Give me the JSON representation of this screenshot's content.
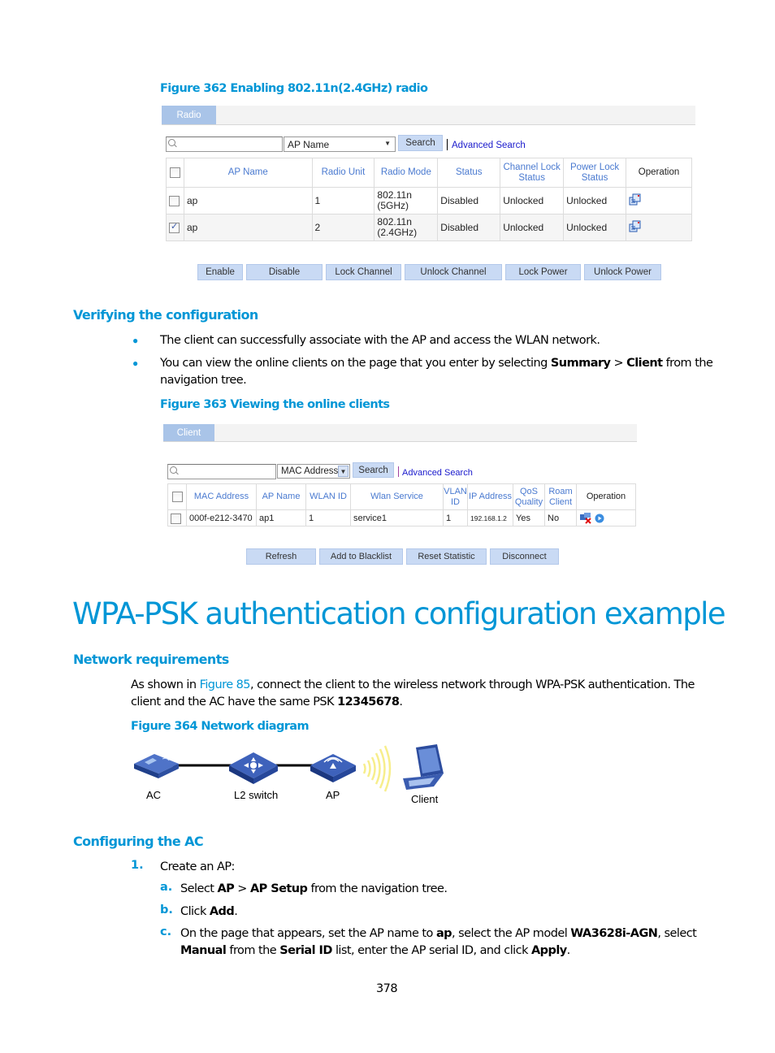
{
  "figure362": {
    "caption": "Figure 362 Enabling 802.11n(2.4GHz) radio",
    "tab": "Radio",
    "search": {
      "placeholder": "",
      "field": "AP Name",
      "button": "Search",
      "advanced": "Advanced Search"
    },
    "columns": [
      "AP Name",
      "Radio Unit",
      "Radio Mode",
      "Status",
      "Channel Lock Status",
      "Power Lock Status",
      "Operation"
    ],
    "rows": [
      {
        "checked": false,
        "ap_name": "ap",
        "radio_unit": "1",
        "mode_line1": "802.11n",
        "mode_line2": "(5GHz)",
        "status": "Disabled",
        "channel_lock": "Unlocked",
        "power_lock": "Unlocked",
        "operation_icon": "details-icon"
      },
      {
        "checked": true,
        "ap_name": "ap",
        "radio_unit": "2",
        "mode_line1": "802.11n",
        "mode_line2": "(2.4GHz)",
        "status": "Disabled",
        "channel_lock": "Unlocked",
        "power_lock": "Unlocked",
        "operation_icon": "details-icon"
      }
    ],
    "buttons": [
      "Enable",
      "Disable",
      "Lock Channel",
      "Unlock Channel",
      "Lock Power",
      "Unlock Power"
    ]
  },
  "verify": {
    "heading": "Verifying the configuration",
    "bullet1": "The client can successfully associate with the AP and access the WLAN network.",
    "bullet2_pre": "You can view the online clients on the page that you enter by selecting ",
    "bullet2_b1": "Summary",
    "bullet2_mid": " > ",
    "bullet2_b2": "Client",
    "bullet2_post": " from the",
    "bullet2_line2": "navigation tree."
  },
  "figure363": {
    "caption": "Figure 363 Viewing the online clients",
    "tab": "Client",
    "search": {
      "field": "MAC Address",
      "button": "Search",
      "advanced": "Advanced Search"
    },
    "columns": {
      "mac": "MAC Address",
      "ap": "AP Name",
      "wlan": "WLAN ID",
      "service": "Wlan Service",
      "vlan1": "VLAN",
      "vlan2": "ID",
      "ip": "IP Address",
      "qos1": "QoS",
      "qos2": "Quality",
      "roam1": "Roam",
      "roam2": "Client",
      "op": "Operation"
    },
    "rows": [
      {
        "checked": false,
        "mac": "000f-e212-3470",
        "ap": "ap1",
        "wlan": "1",
        "service": "service1",
        "vlan": "1",
        "ip": "192.168.1.2",
        "qos": "Yes",
        "roam": "No"
      }
    ],
    "buttons": [
      "Refresh",
      "Add to Blacklist",
      "Reset Statistic",
      "Disconnect"
    ]
  },
  "section": {
    "title": "WPA-PSK authentication configuration example",
    "netreq_heading": "Network requirements",
    "para_pre": "As shown in ",
    "para_link": "Figure 85",
    "para_mid": ", connect the client to the wireless network through WPA-PSK authentication. The",
    "para_line2_pre": "client and the AC have the same PSK ",
    "para_psk": "12345678",
    "para_line2_post": ".",
    "fig364_caption": "Figure 364 Network diagram",
    "diagram_labels": {
      "ac": "AC",
      "switch": "L2 switch",
      "ap": "AP",
      "client": "Client"
    },
    "configac_heading": "Configuring the AC",
    "step1_marker": "1.",
    "step1": "Create an AP:",
    "a_marker": "a.",
    "a_pre": "Select ",
    "a_b1": "AP",
    "a_mid": " > ",
    "a_b2": "AP Setup",
    "a_post": " from the navigation tree.",
    "b_marker": "b.",
    "b_pre": "Click ",
    "b_b1": "Add",
    "b_post": ".",
    "c_marker": "c.",
    "c_pre": "On the page that appears, set the AP name to ",
    "c_b1": "ap",
    "c_mid1": ", select the AP model ",
    "c_b2": "WA3628i-AGN",
    "c_mid2": ", select",
    "c_b3": "Manual",
    "c_mid3": " from the ",
    "c_b4": "Serial ID",
    "c_mid4": " list, enter the AP serial ID, and click ",
    "c_b5": "Apply",
    "c_post": "."
  },
  "page_number": "378"
}
